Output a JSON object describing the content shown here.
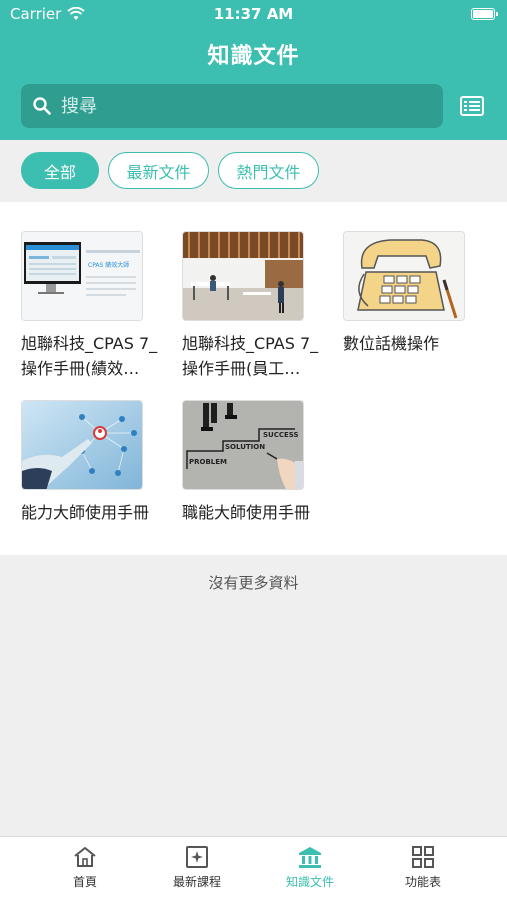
{
  "status_bar": {
    "carrier": "Carrier",
    "time": "11:37 AM"
  },
  "header": {
    "title": "知識文件"
  },
  "search": {
    "placeholder": "搜尋"
  },
  "filters": [
    {
      "label": "全部",
      "active": true
    },
    {
      "label": "最新文件",
      "active": false
    },
    {
      "label": "熱門文件",
      "active": false
    }
  ],
  "documents": [
    {
      "title": "旭聯科技_CPAS 7_操作手冊(績效…",
      "thumb": "screen"
    },
    {
      "title": "旭聯科技_CPAS 7_操作手冊(員工…",
      "thumb": "office"
    },
    {
      "title": "數位話機操作",
      "thumb": "phone"
    },
    {
      "title": "能力大師使用手冊",
      "thumb": "network"
    },
    {
      "title": "職能大師使用手冊",
      "thumb": "stairs"
    }
  ],
  "thumb_text": {
    "screen_badge": "CPAS 績效大師",
    "stairs_problem": "PROBLEM",
    "stairs_solution": "SOLUTION",
    "stairs_success": "SUCCESS"
  },
  "footer_text": "沒有更多資料",
  "tabs": [
    {
      "label": "首頁",
      "icon": "home-icon"
    },
    {
      "label": "最新課程",
      "icon": "new-course-icon"
    },
    {
      "label": "知識文件",
      "icon": "library-icon",
      "active": true
    },
    {
      "label": "功能表",
      "icon": "grid-menu-icon"
    }
  ],
  "colors": {
    "accent": "#3cbfb0",
    "search_bg": "#2f9d90"
  }
}
